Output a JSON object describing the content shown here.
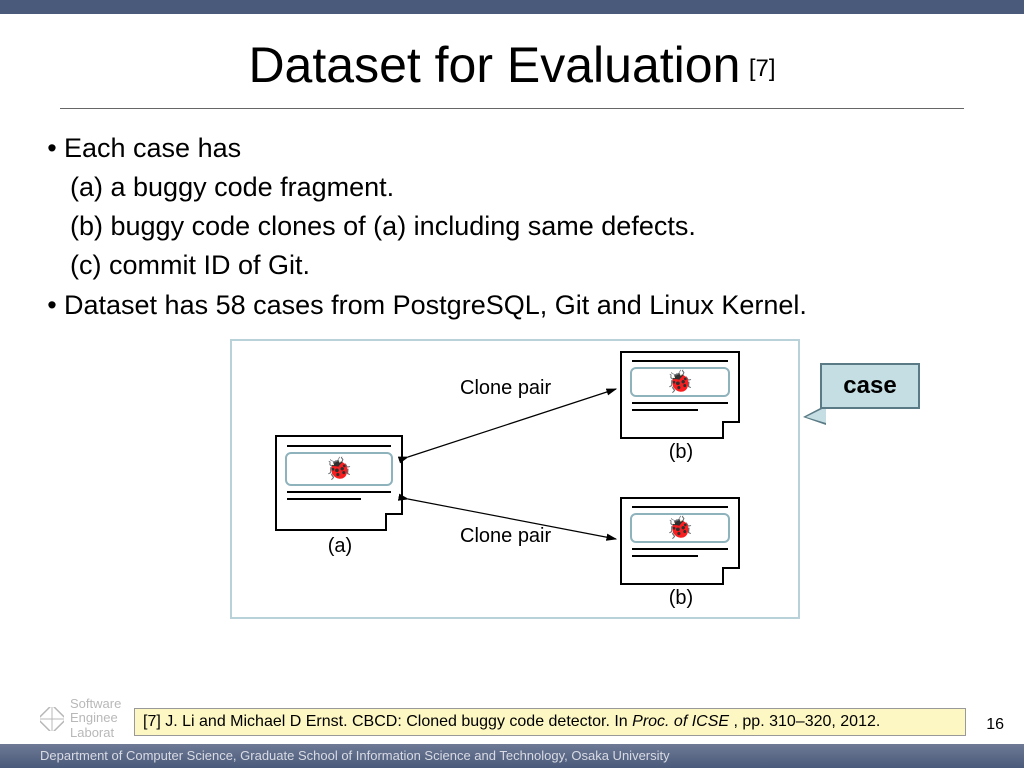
{
  "title": "Dataset for Evaluation",
  "title_ref": "[7]",
  "bullets": {
    "b1": "Each case has",
    "s1": "(a) a buggy code fragment.",
    "s2": "(b) buggy code clones of (a) including same defects.",
    "s3": "(c) commit ID of Git.",
    "b2": "Dataset has 58 cases from PostgreSQL, Git and Linux Kernel."
  },
  "diagram": {
    "clone_pair": "Clone pair",
    "label_a": "(a)",
    "label_b": "(b)",
    "case": "case"
  },
  "citation": {
    "prefix": "[7] J. Li and Michael D Ernst. CBCD: Cloned buggy code detector. In ",
    "venue": "Proc. of ICSE ",
    "suffix": ", pp. 310–320, 2012."
  },
  "page_number": "16",
  "footer": "Department of Computer Science, Graduate School of Information Science and Technology, Osaka University",
  "logo": {
    "l1": "Software",
    "l2": "Enginee",
    "l3": "Laborat"
  }
}
